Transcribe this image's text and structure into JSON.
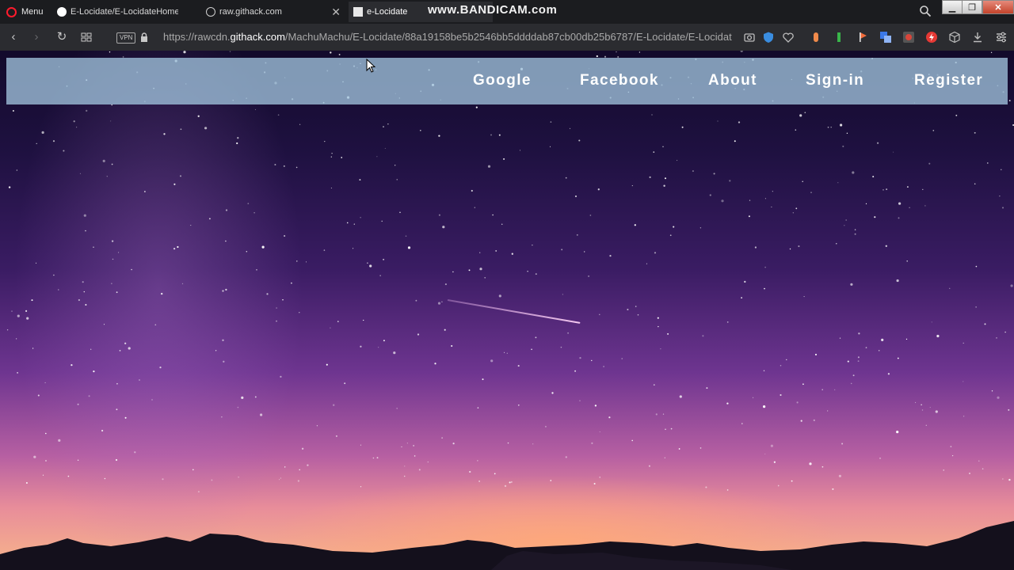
{
  "browser": {
    "menu_label": "Menu",
    "tabs": [
      {
        "title": "E-Locidate/E-LocidateHome.h",
        "icon": "github-icon"
      },
      {
        "title": "raw.githack.com",
        "icon": "cloud-icon"
      },
      {
        "title": "e-Locidate",
        "icon": "document-icon"
      }
    ],
    "watermark": "www.BANDICAM.com",
    "address": {
      "prefix": "https://rawcdn.",
      "host": "githack.com",
      "path": "/MachuMachu/E-Locidate/88a19158be5b2546bb5ddddab87cb00db25b6787/E-Locidate/E-Locidat"
    },
    "vpn_label": "VPN",
    "accent_color": "#ff1b2d"
  },
  "site": {
    "nav": {
      "google": "Google",
      "facebook": "Facebook",
      "about": "About",
      "signin": "Sign-in",
      "register": "Register"
    },
    "nav_bar_color": "#a0c3dc",
    "background": "starry night sky over mountain silhouettes"
  }
}
